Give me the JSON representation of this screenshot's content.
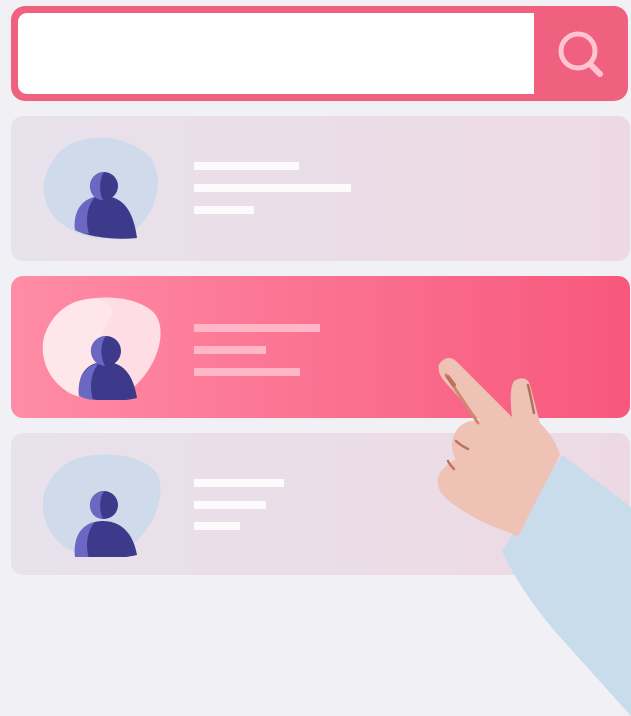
{
  "search": {
    "value": "",
    "placeholder": "",
    "icon": "search-icon"
  },
  "results": {
    "items": [
      {
        "state": "default",
        "avatar_icon": "user-icon"
      },
      {
        "state": "selected",
        "avatar_icon": "user-icon"
      },
      {
        "state": "default",
        "avatar_icon": "user-icon"
      }
    ]
  },
  "colors": {
    "accent": "#f0607f",
    "accent_gradient_start": "#ff8ca6",
    "accent_gradient_end": "#f7587c",
    "card_default": "#ece0ea",
    "background": "#f0f0f5",
    "avatar_figure": "#3d3a8c",
    "avatar_blob": "#cfdbeb",
    "skin": "#efc2b6",
    "sleeve": "#c8dcec"
  },
  "illustration": {
    "pointer": "pointing-hand-icon"
  }
}
